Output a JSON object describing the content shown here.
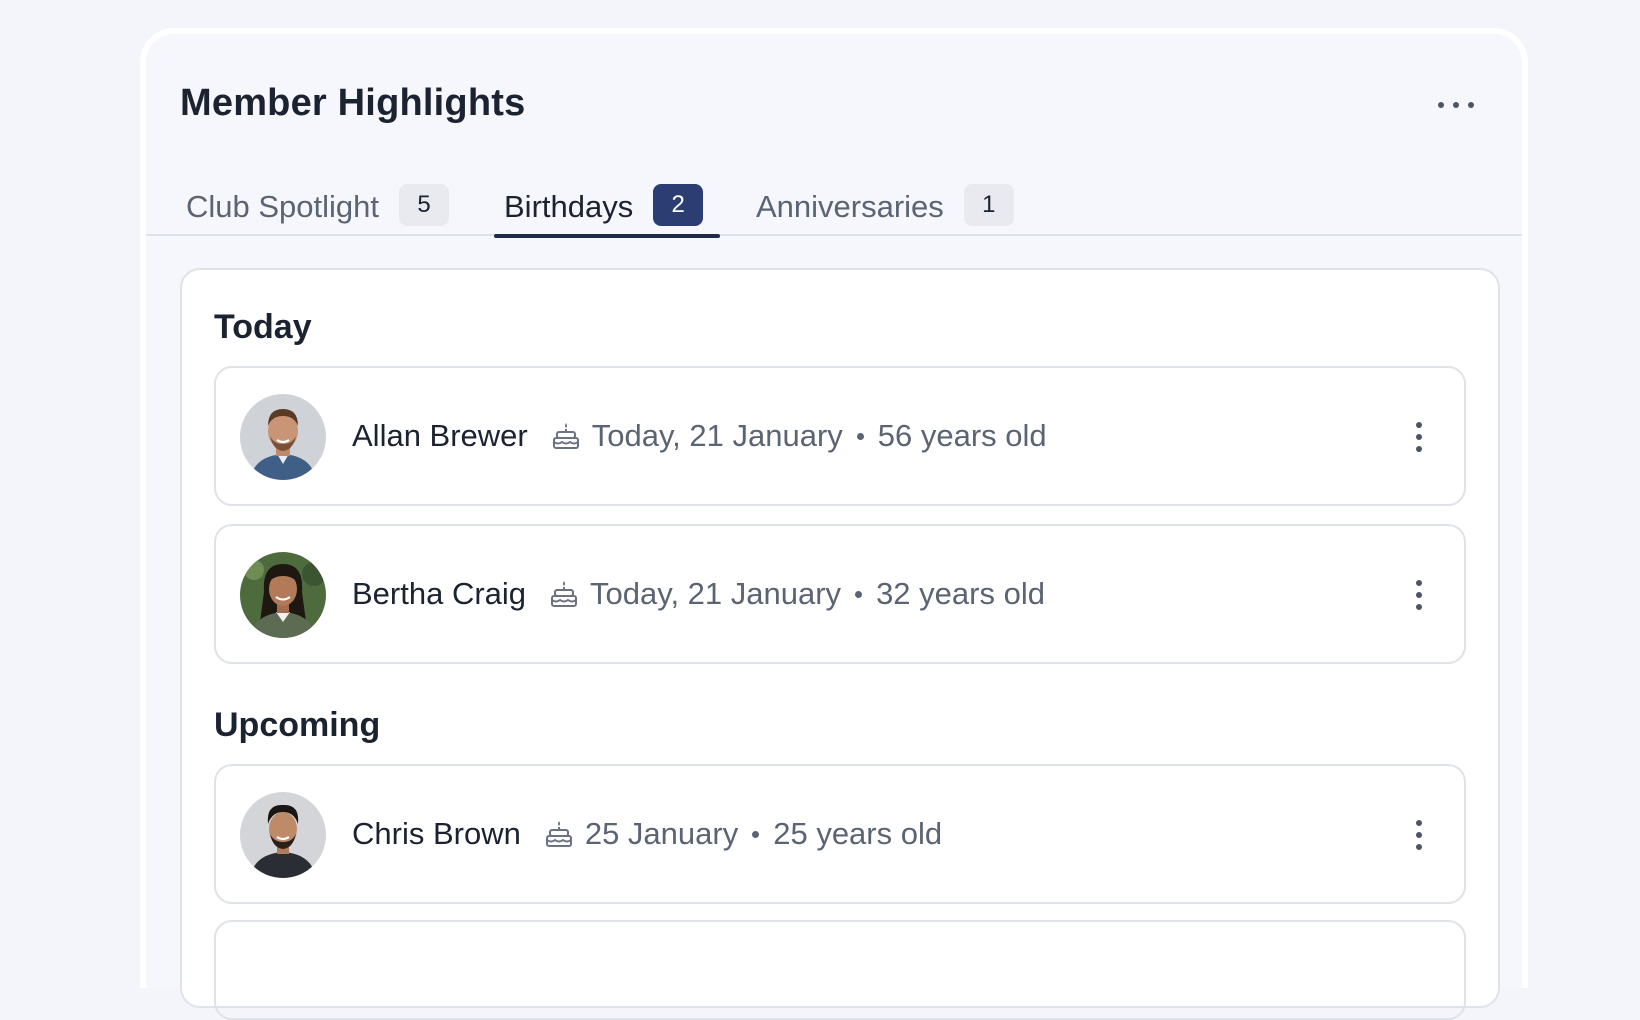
{
  "widget": {
    "title": "Member Highlights",
    "more_icon": "more-horizontal-icon"
  },
  "tabs": [
    {
      "label": "Club Spotlight",
      "count": "5",
      "active": false
    },
    {
      "label": "Birthdays",
      "count": "2",
      "active": true
    },
    {
      "label": "Anniversaries",
      "count": "1",
      "active": false
    }
  ],
  "colors": {
    "accent": "#2b3d72",
    "background": "#f4f5fa",
    "text_primary": "#1b2230",
    "text_secondary": "#5b6473"
  },
  "sections": {
    "today": {
      "title": "Today",
      "members": [
        {
          "name": "Allan Brewer",
          "date": "Today, 21 January",
          "age": "56 years old",
          "icon": "cake-icon",
          "menu_icon": "more-vertical-icon"
        },
        {
          "name": "Bertha Craig",
          "date": "Today, 21 January",
          "age": "32 years old",
          "icon": "cake-icon",
          "menu_icon": "more-vertical-icon"
        }
      ]
    },
    "upcoming": {
      "title": "Upcoming",
      "members": [
        {
          "name": "Chris Brown",
          "date": "25 January",
          "age": "25 years old",
          "icon": "cake-icon",
          "menu_icon": "more-vertical-icon"
        }
      ]
    }
  }
}
